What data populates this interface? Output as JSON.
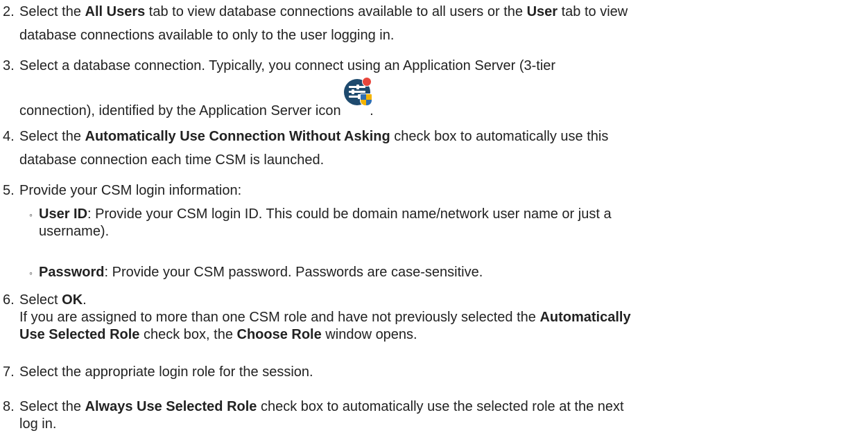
{
  "steps": [
    {
      "number": "2.",
      "lines": [
        [
          "Select the ",
          {
            "b": "All Users"
          },
          " tab to view database connections available to all users or the ",
          {
            "b": "User"
          },
          " tab to view"
        ],
        [
          "database connections available to only to the user logging in."
        ]
      ]
    },
    {
      "number": "3.",
      "lines": [
        [
          "Select a database connection. Typically, you connect using an Application Server (3-tier"
        ],
        [
          "connection), identified by the Application Server icon ",
          "."
        ]
      ]
    },
    {
      "number": "4.",
      "lines": [
        [
          "Select the ",
          {
            "b": "Automatically Use Connection Without Asking"
          },
          " check box to automatically use this"
        ],
        [
          "database connection each time CSM is launched."
        ]
      ]
    },
    {
      "number": "5.",
      "lines": [
        [
          "Provide your CSM login information:"
        ]
      ],
      "bullets": [
        {
          "lines": [
            [
              {
                "b": "User ID"
              },
              ": Provide your CSM login ID. This could be domain name/network user name or just a"
            ],
            [
              "username)."
            ]
          ]
        },
        {
          "lines": [
            [
              {
                "b": "Password"
              },
              ": Provide your CSM password. Passwords are case-sensitive."
            ]
          ]
        }
      ]
    },
    {
      "number": "6.",
      "lines": [
        [
          "Select ",
          {
            "b": "OK"
          },
          "."
        ],
        [
          "If you are assigned to more than one CSM role and have not previously selected the ",
          {
            "b": "Automatically"
          }
        ],
        [
          {
            "b": "Use Selected Role"
          },
          " check box, the ",
          {
            "b": "Choose Role"
          },
          " window opens."
        ]
      ]
    },
    {
      "number": "7.",
      "lines": [
        [
          "Select the appropriate login role for the session."
        ]
      ]
    },
    {
      "number": "8.",
      "lines": [
        [
          "Select the ",
          {
            "b": "Always Use Selected Role"
          },
          " check box to automatically use the selected role at the next"
        ],
        [
          "log in."
        ]
      ]
    }
  ],
  "bullet_glyph": "◦",
  "icons": {
    "app_server": "application-server-icon"
  },
  "colors": {
    "text": "#222222",
    "icon_bg": "#1e4a6e"
  }
}
